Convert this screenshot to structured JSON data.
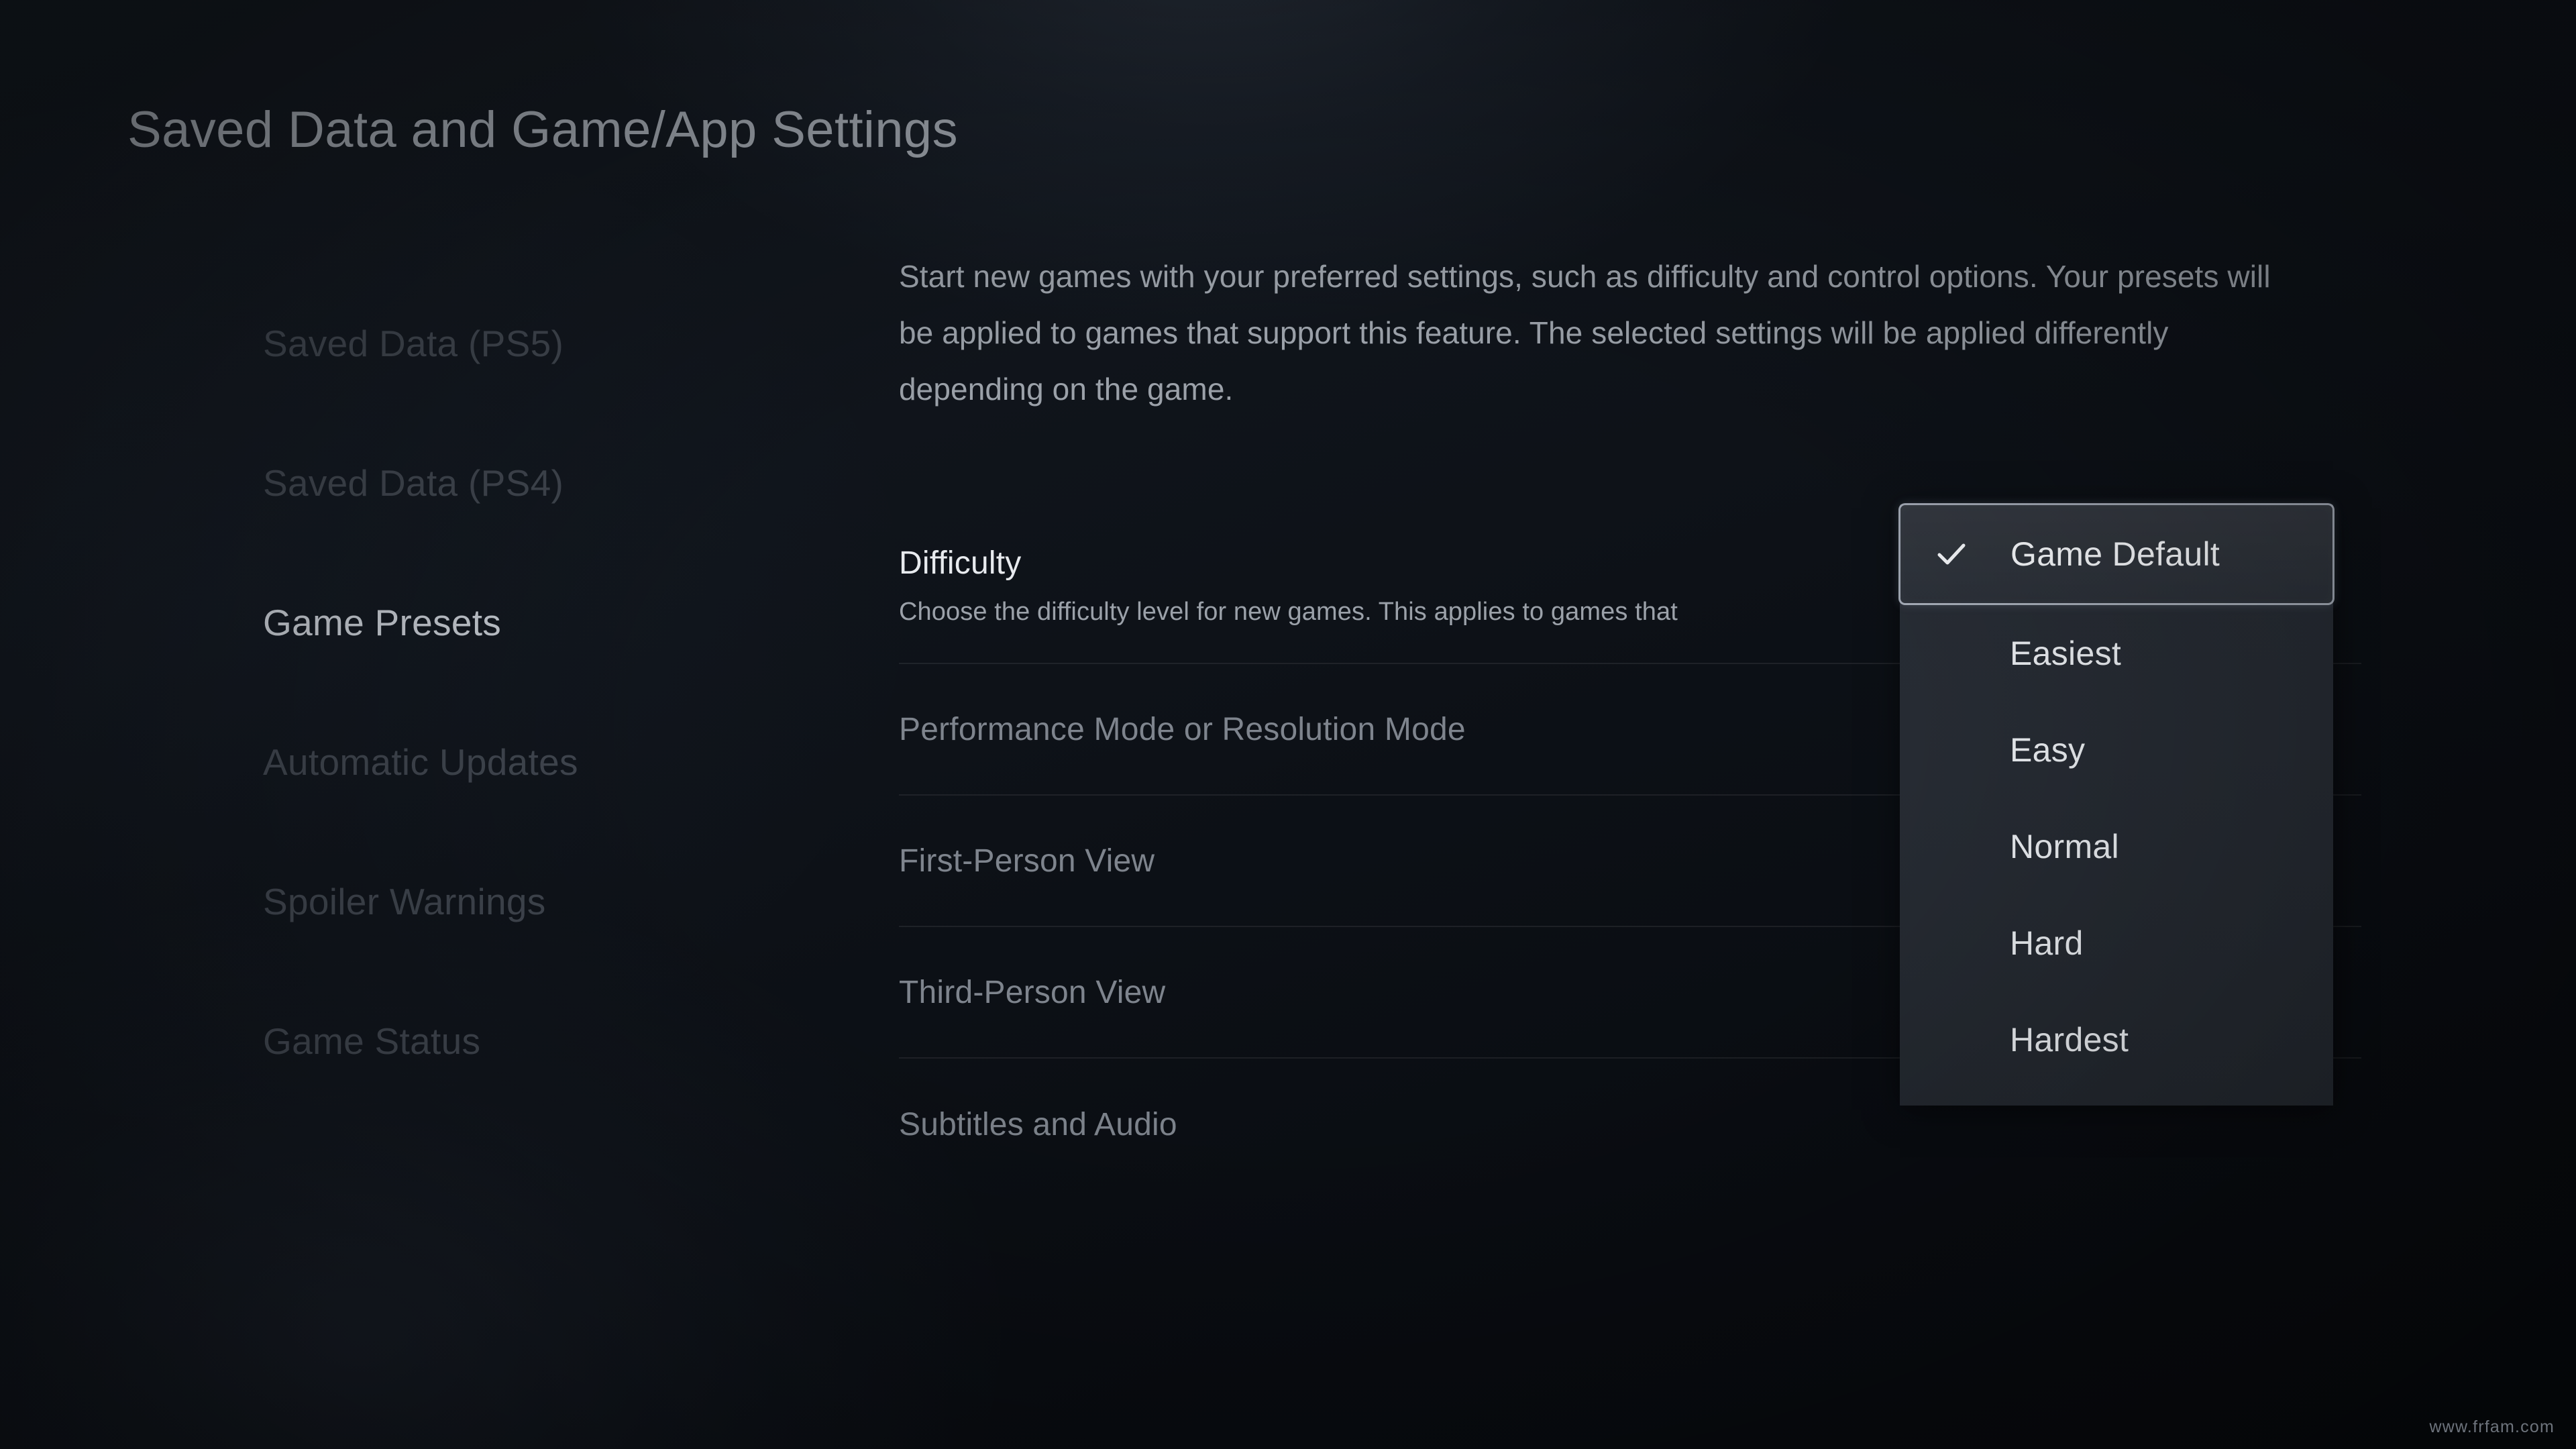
{
  "page": {
    "title": "Saved Data and Game/App Settings",
    "watermark": "www.frfam.com"
  },
  "sidebar": {
    "items": [
      {
        "label": "Saved Data (PS5)",
        "active": false
      },
      {
        "label": "Saved Data (PS4)",
        "active": false
      },
      {
        "label": "Game Presets",
        "active": true
      },
      {
        "label": "Automatic Updates",
        "active": false
      },
      {
        "label": "Spoiler Warnings",
        "active": false
      },
      {
        "label": "Game Status",
        "active": false
      }
    ]
  },
  "main": {
    "intro": "Start new games with your preferred settings, such as difficulty and control options. Your presets will be applied to games that support this feature. The selected settings will be applied differently depending on the game.",
    "rows": [
      {
        "label": "Difficulty",
        "description": "Choose the difficulty level for new games. This applies to games that",
        "selected": true
      },
      {
        "label": "Performance Mode or Resolution Mode",
        "description": "",
        "selected": false
      },
      {
        "label": "First-Person View",
        "description": "",
        "selected": false
      },
      {
        "label": "Third-Person View",
        "description": "",
        "selected": false
      },
      {
        "label": "Subtitles and Audio",
        "description": "",
        "selected": false
      }
    ]
  },
  "dropdown": {
    "open": true,
    "for_setting": "Difficulty",
    "selected_value": "Game Default",
    "check_icon": "check-icon",
    "options": [
      {
        "label": "Game Default",
        "checked": true
      },
      {
        "label": "Easiest",
        "checked": false
      },
      {
        "label": "Easy",
        "checked": false
      },
      {
        "label": "Normal",
        "checked": false
      },
      {
        "label": "Hard",
        "checked": false
      },
      {
        "label": "Hardest",
        "checked": false
      }
    ]
  },
  "colors": {
    "background": "#0d1117",
    "panel": "#262b33",
    "text_primary": "#e9ecf0",
    "text_secondary": "#9ba1a9",
    "text_dim": "#40464f",
    "highlight_border": "#c4ccd8"
  }
}
